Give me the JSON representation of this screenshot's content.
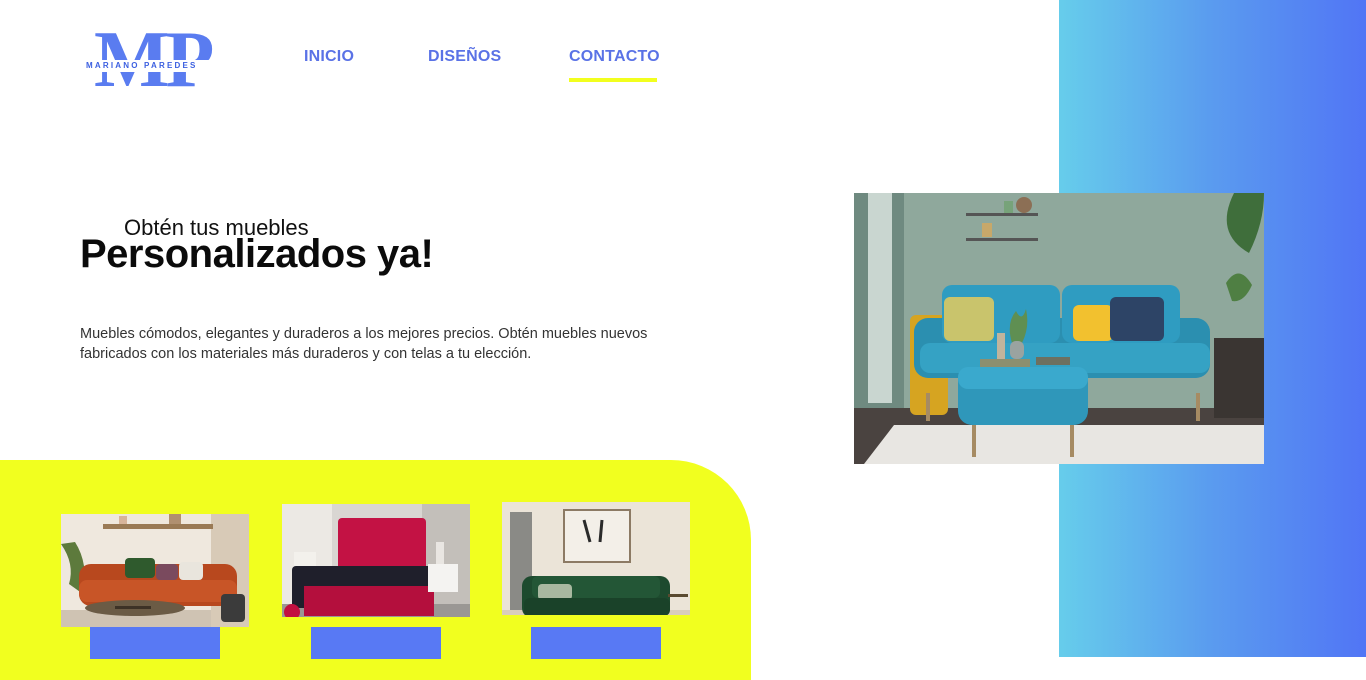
{
  "logo": {
    "letters": "MP",
    "name": "MARIANO PAREDES"
  },
  "nav": {
    "items": [
      "INICIO",
      "DISEÑOS",
      "CONTACTO"
    ],
    "active": "CONTACTO"
  },
  "hero": {
    "pretitle": "Obtén tus muebles",
    "title": "Personalizados ya!",
    "description": "Muebles cómodos, elegantes y duraderos a los mejores precios. Obtén muebles nuevos fabricados con los materiales más duraderos y con telas a tu elección."
  },
  "colors": {
    "accent": "#5a72e6",
    "highlight": "#f1ff1f",
    "gradient_start": "#66cdeb",
    "gradient_end": "#5175f5",
    "button": "#5879f4"
  },
  "images": {
    "hero": "living-room-teal-sofa",
    "cards": [
      "orange-sofa",
      "red-bed",
      "green-sofa"
    ]
  }
}
